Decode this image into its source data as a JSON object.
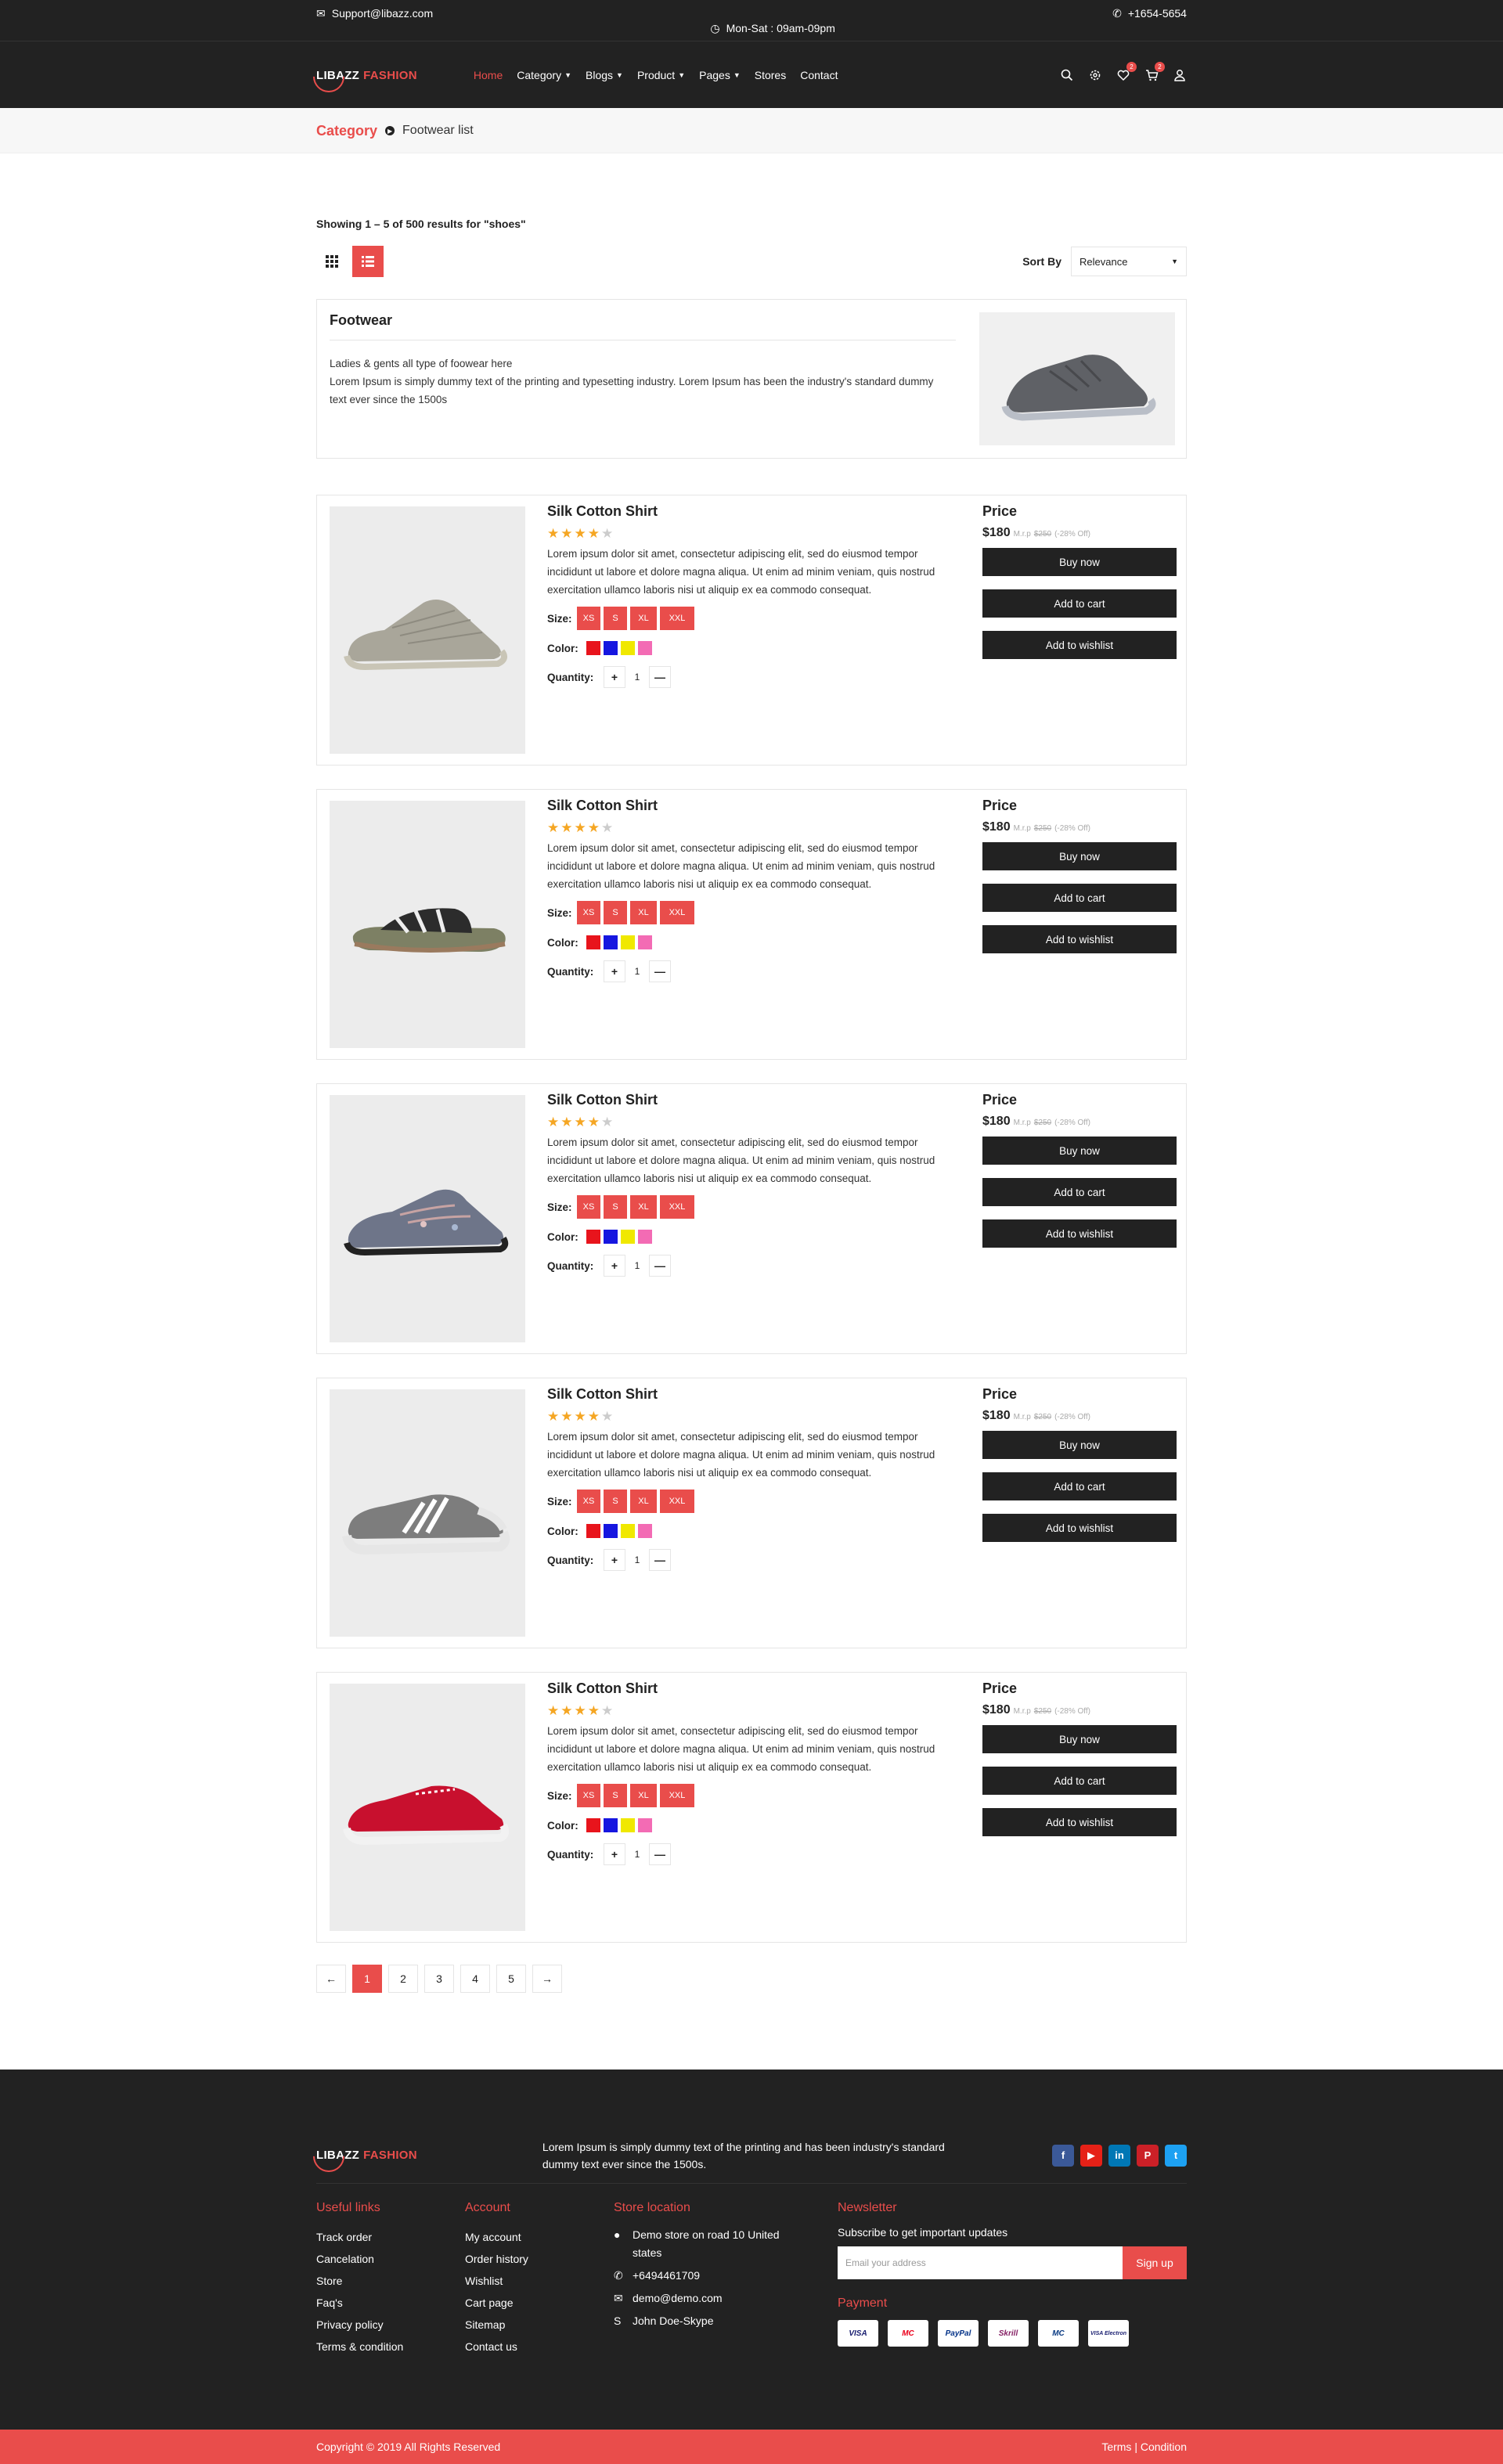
{
  "topbar": {
    "email": "Support@libazz.com",
    "hours": "Mon-Sat : 09am-09pm",
    "phone": "+1654-5654"
  },
  "brand": {
    "name_part1": "LIBAZZ",
    "name_part2": "FASHION"
  },
  "nav": [
    {
      "label": "Home",
      "active": true,
      "dropdown": false
    },
    {
      "label": "Category",
      "active": false,
      "dropdown": true
    },
    {
      "label": "Blogs",
      "active": false,
      "dropdown": true
    },
    {
      "label": "Product",
      "active": false,
      "dropdown": true
    },
    {
      "label": "Pages",
      "active": false,
      "dropdown": true
    },
    {
      "label": "Stores",
      "active": false,
      "dropdown": false
    },
    {
      "label": "Contact",
      "active": false,
      "dropdown": false
    }
  ],
  "nav_icons": {
    "wishlist_count": "2",
    "cart_count": "2"
  },
  "breadcrumb": {
    "main": "Category",
    "current": "Footwear list"
  },
  "results_text": "Showing 1 – 5 of 500 results for \"shoes\"",
  "sort": {
    "label": "Sort By",
    "value": "Relevance"
  },
  "category": {
    "title": "Footwear",
    "line1": "Ladies & gents all type of foowear here",
    "line2": "Lorem Ipsum is simply dummy text of the printing and typesetting industry. Lorem Ipsum has been the industry's standard dummy text ever since the 1500s"
  },
  "labels": {
    "size": "Size:",
    "color": "Color:",
    "quantity": "Quantity:",
    "price": "Price",
    "buy_now": "Buy now",
    "add_to_cart": "Add to cart",
    "add_to_wishlist": "Add to wishlist",
    "plus": "+",
    "minus": "—"
  },
  "sizes": [
    "XS",
    "S",
    "XL",
    "XXL"
  ],
  "colors": [
    "#e8141c",
    "#1616e0",
    "#f0e800",
    "#f36bb4"
  ],
  "products": [
    {
      "name": "Silk Cotton Shirt",
      "rating": 4,
      "desc": "Lorem ipsum dolor sit amet, consectetur adipiscing elit, sed do eiusmod tempor incididunt ut labore et dolore magna aliqua. Ut enim ad minim veniam, quis nostrud exercitation ullamco laboris nisi ut aliquip ex ea commodo consequat.",
      "price": "$180",
      "mrp_label": "M.r.p",
      "mrp": "$250",
      "discount": "(-28% Off)",
      "qty": "1",
      "shoe": "sneaker-gray"
    },
    {
      "name": "Silk Cotton Shirt",
      "rating": 4,
      "desc": "Lorem ipsum dolor sit amet, consectetur adipiscing elit, sed do eiusmod tempor incididunt ut labore et dolore magna aliqua. Ut enim ad minim veniam, quis nostrud exercitation ullamco laboris nisi ut aliquip ex ea commodo consequat.",
      "price": "$180",
      "mrp_label": "M.r.p",
      "mrp": "$250",
      "discount": "(-28% Off)",
      "qty": "1",
      "shoe": "slide-camo"
    },
    {
      "name": "Silk Cotton Shirt",
      "rating": 4,
      "desc": "Lorem ipsum dolor sit amet, consectetur adipiscing elit, sed do eiusmod tempor incididunt ut labore et dolore magna aliqua. Ut enim ad minim veniam, quis nostrud exercitation ullamco laboris nisi ut aliquip ex ea commodo consequat.",
      "price": "$180",
      "mrp_label": "M.r.p",
      "mrp": "$250",
      "discount": "(-28% Off)",
      "qty": "1",
      "shoe": "runner-floral"
    },
    {
      "name": "Silk Cotton Shirt",
      "rating": 4,
      "desc": "Lorem ipsum dolor sit amet, consectetur adipiscing elit, sed do eiusmod tempor incididunt ut labore et dolore magna aliqua. Ut enim ad minim veniam, quis nostrud exercitation ullamco laboris nisi ut aliquip ex ea commodo consequat.",
      "price": "$180",
      "mrp_label": "M.r.p",
      "mrp": "$250",
      "discount": "(-28% Off)",
      "qty": "1",
      "shoe": "superstar-gray"
    },
    {
      "name": "Silk Cotton Shirt",
      "rating": 4,
      "desc": "Lorem ipsum dolor sit amet, consectetur adipiscing elit, sed do eiusmod tempor incididunt ut labore et dolore magna aliqua. Ut enim ad minim veniam, quis nostrud exercitation ullamco laboris nisi ut aliquip ex ea commodo consequat.",
      "price": "$180",
      "mrp_label": "M.r.p",
      "mrp": "$250",
      "discount": "(-28% Off)",
      "qty": "1",
      "shoe": "canvas-red"
    }
  ],
  "pagination": {
    "prev": "←",
    "pages": [
      "1",
      "2",
      "3",
      "4",
      "5"
    ],
    "current": "1",
    "next": "→"
  },
  "footer": {
    "tagline": "Lorem Ipsum is simply dummy text of the printing and has been industry's standard dummy text ever since the 1500s.",
    "social": [
      {
        "name": "facebook-icon",
        "glyph": "f",
        "color": "#3b5998"
      },
      {
        "name": "youtube-icon",
        "glyph": "▶",
        "color": "#e62117"
      },
      {
        "name": "linkedin-icon",
        "glyph": "in",
        "color": "#0077b5"
      },
      {
        "name": "pinterest-icon",
        "glyph": "P",
        "color": "#cb2027"
      },
      {
        "name": "twitter-icon",
        "glyph": "t",
        "color": "#1da1f2"
      }
    ],
    "useful": {
      "title": "Useful links",
      "links": [
        "Track order",
        "Cancelation",
        "Store",
        "Faq's",
        "Privacy policy",
        "Terms & condition"
      ]
    },
    "account": {
      "title": "Account",
      "links": [
        "My account",
        "Order history",
        "Wishlist",
        "Cart page",
        "Sitemap",
        "Contact us"
      ]
    },
    "store": {
      "title": "Store location",
      "address": "Demo store on road 10 United states",
      "phone": "+6494461709",
      "email": "demo@demo.com",
      "skype": "John Doe-Skype"
    },
    "newsletter": {
      "title": "Newsletter",
      "subtitle": "Subscribe to get important updates",
      "placeholder": "Email your address",
      "button": "Sign up"
    },
    "payment": {
      "title": "Payment",
      "cards": [
        "VISA",
        "MC",
        "PayPal",
        "Skrill",
        "MC",
        "VISA Electron"
      ]
    }
  },
  "copyright": {
    "text": "Copyright © 2019 All Rights Reserved",
    "terms": "Terms | Condition"
  },
  "accent_color": "#e94d4b"
}
